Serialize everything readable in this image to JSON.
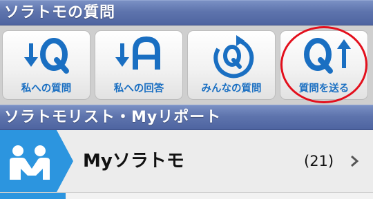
{
  "header": {
    "title": "ソラトモの質問"
  },
  "tiles": [
    {
      "label": "私への質問",
      "icon": "arrow-down-q-icon"
    },
    {
      "label": "私への回答",
      "icon": "arrow-down-a-icon"
    },
    {
      "label": "みんなの質問",
      "icon": "refresh-q-icon"
    },
    {
      "label": "質問を送る",
      "icon": "q-arrow-up-icon"
    }
  ],
  "list_header": {
    "title": "ソラトモリスト・Myリポート"
  },
  "list": [
    {
      "title": "Myソラトモ",
      "count": "(21)",
      "icon": "handshake-icon"
    }
  ],
  "colors": {
    "header_blue": "#5e74ad",
    "icon_blue": "#1a6fc2",
    "highlight_red": "#e30f1c",
    "row_icon_bg": "#2c95df"
  }
}
